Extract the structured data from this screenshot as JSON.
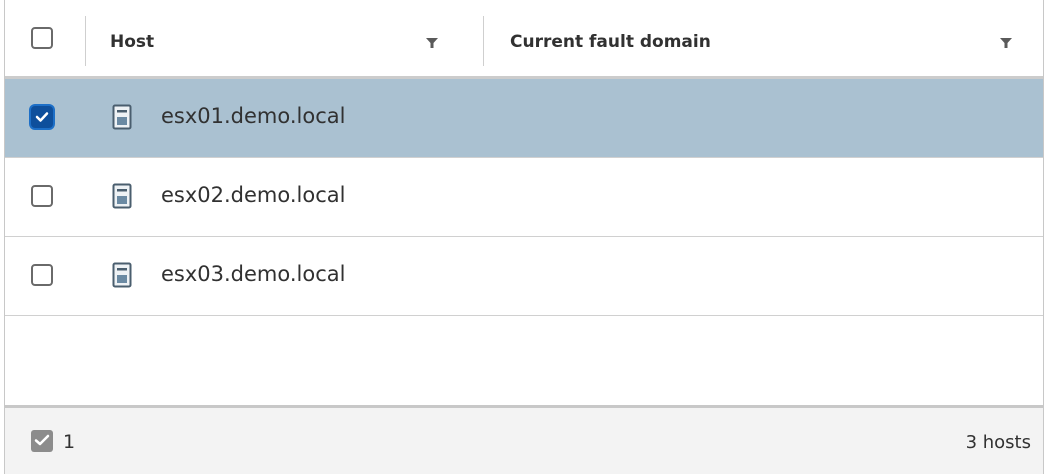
{
  "header": {
    "host_label": "Host",
    "fault_domain_label": "Current fault domain"
  },
  "rows": [
    {
      "host": "esx01.demo.local",
      "fault_domain": "",
      "selected": true
    },
    {
      "host": "esx02.demo.local",
      "fault_domain": "",
      "selected": false
    },
    {
      "host": "esx03.demo.local",
      "fault_domain": "",
      "selected": false
    }
  ],
  "footer": {
    "selected_count": "1",
    "total": "3 hosts"
  },
  "icons": {
    "header_checkbox": "checkbox-icon",
    "filter": "filter-icon",
    "host": "server-host-icon",
    "check": "checkmark-icon"
  },
  "colors": {
    "selected_row": "#aac1d1",
    "checkbox_checked": "#0e4f9c",
    "footer_bg": "#f3f3f3"
  }
}
